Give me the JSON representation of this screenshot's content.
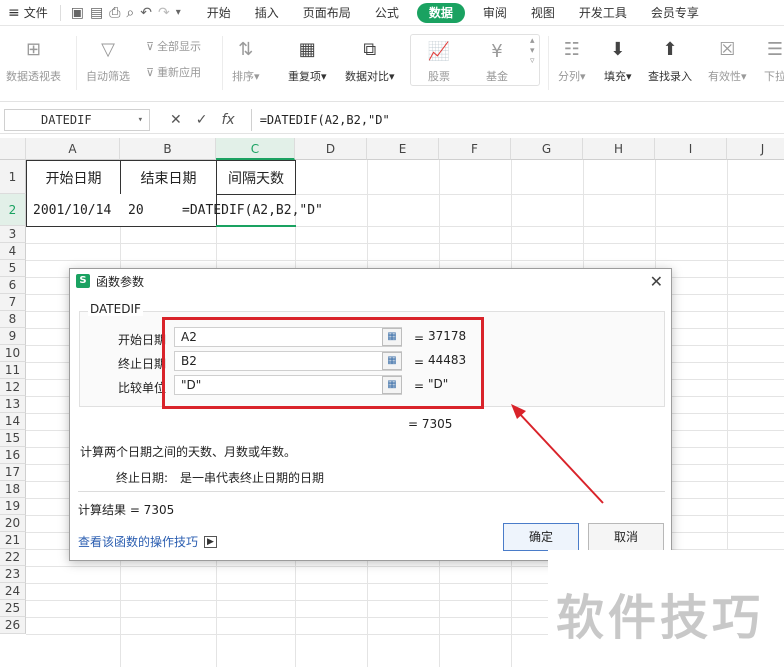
{
  "menubar": {
    "file": "文件",
    "tabs": [
      "开始",
      "插入",
      "页面布局",
      "公式",
      "数据",
      "审阅",
      "视图",
      "开发工具",
      "会员专享"
    ],
    "active_tab": "数据"
  },
  "ribbon": {
    "pivot": "数据透视表",
    "autofilter": "自动筛选",
    "show_all": "全部显示",
    "reapply": "重新应用",
    "sort": "排序",
    "duplicates": "重复项",
    "compare": "数据对比",
    "stocks": "股票",
    "funds": "基金",
    "split": "分列",
    "fill": "填充",
    "lookup": "查找录入",
    "validity": "有效性",
    "dropdown": "下拉"
  },
  "formula_bar": {
    "name_box": "DATEDIF",
    "fx": "fx",
    "formula": "=DATEDIF(A2,B2,\"D\""
  },
  "grid": {
    "columns": [
      "A",
      "B",
      "C",
      "D",
      "E",
      "F",
      "G",
      "H",
      "I",
      "J"
    ],
    "rows": [
      "1",
      "2",
      "3",
      "4",
      "5",
      "6",
      "7",
      "8",
      "9",
      "10",
      "11",
      "12",
      "13",
      "14",
      "15",
      "16",
      "17",
      "18",
      "19",
      "20",
      "21",
      "22",
      "23",
      "24",
      "25",
      "26"
    ],
    "a1": "开始日期",
    "b1": "结束日期",
    "c1": "间隔天数",
    "a2": "2001/10/14",
    "b2": "20",
    "c2_formula": "=DATEDIF(A2,B2,\"D\""
  },
  "dialog": {
    "title": "函数参数",
    "function_name": "DATEDIF",
    "args": [
      {
        "label": "开始日期",
        "value": "A2",
        "result": "37178"
      },
      {
        "label": "终止日期",
        "value": "B2",
        "result": "44483"
      },
      {
        "label": "比较单位",
        "value": "\"D\"",
        "result": "\"D\""
      }
    ],
    "eq": "=",
    "formula_result": "= 7305",
    "description": "计算两个日期之间的天数、月数或年数。",
    "param_help_label": "终止日期:",
    "param_help_text": "是一串代表终止日期的日期",
    "calc_result": "计算结果 =  7305",
    "help_link": "查看该函数的操作技巧",
    "ok": "确定",
    "cancel": "取消"
  },
  "watermark": "软件技巧",
  "colors": {
    "accent": "#1aa261",
    "highlight": "#d9232a"
  }
}
